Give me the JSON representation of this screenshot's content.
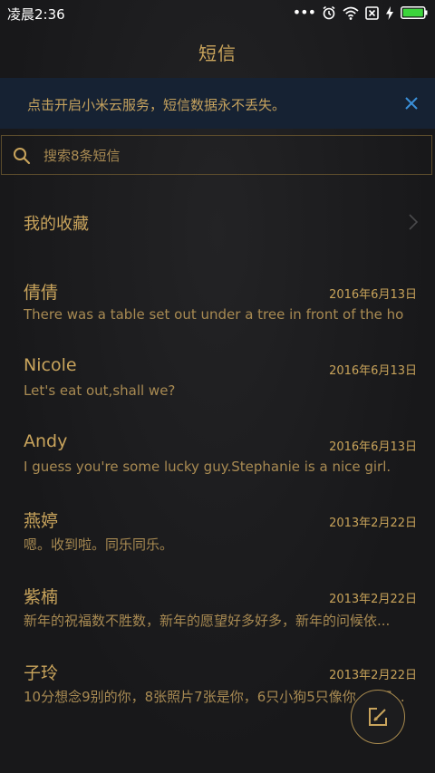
{
  "status_bar": {
    "time": "凌晨2:36",
    "dots": "•••"
  },
  "header": {
    "title": "短信"
  },
  "banner": {
    "text": "点击开启小米云服务，短信数据永不丢失。"
  },
  "search": {
    "placeholder": "搜索8条短信"
  },
  "favorites": {
    "label": "我的收藏"
  },
  "messages": [
    {
      "name": "倩倩",
      "date": "2016年6月13日",
      "preview": "There was a table set out under a tree in front of the hous"
    },
    {
      "name": "Nicole",
      "date": "2016年6月13日",
      "preview": "Let's eat out,shall we?"
    },
    {
      "name": "Andy",
      "date": "2016年6月13日",
      "preview": "I guess you're some lucky guy.Stephanie is a nice girl."
    },
    {
      "name": "燕婷",
      "date": "2013年2月22日",
      "preview": "嗯。收到啦。同乐同乐。"
    },
    {
      "name": "紫楠",
      "date": "2013年2月22日",
      "preview": "新年的祝福数不胜数，新年的愿望好多好多，新年的问候依..."
    },
    {
      "name": "子玲",
      "date": "2013年2月22日",
      "preview": "10分想念9别的你，8张照片7张是你，6只小狗5只像你，4相..."
    }
  ],
  "colors": {
    "accent": "#c9a45c",
    "banner_bg": "#162233",
    "close": "#3a8fd8",
    "background": "#1b1b1d"
  },
  "icons": [
    "wifi-icon",
    "alarm-icon",
    "sim-icon",
    "charging-icon",
    "battery-icon",
    "close-icon",
    "search-icon",
    "chevron-right-icon",
    "compose-icon"
  ]
}
